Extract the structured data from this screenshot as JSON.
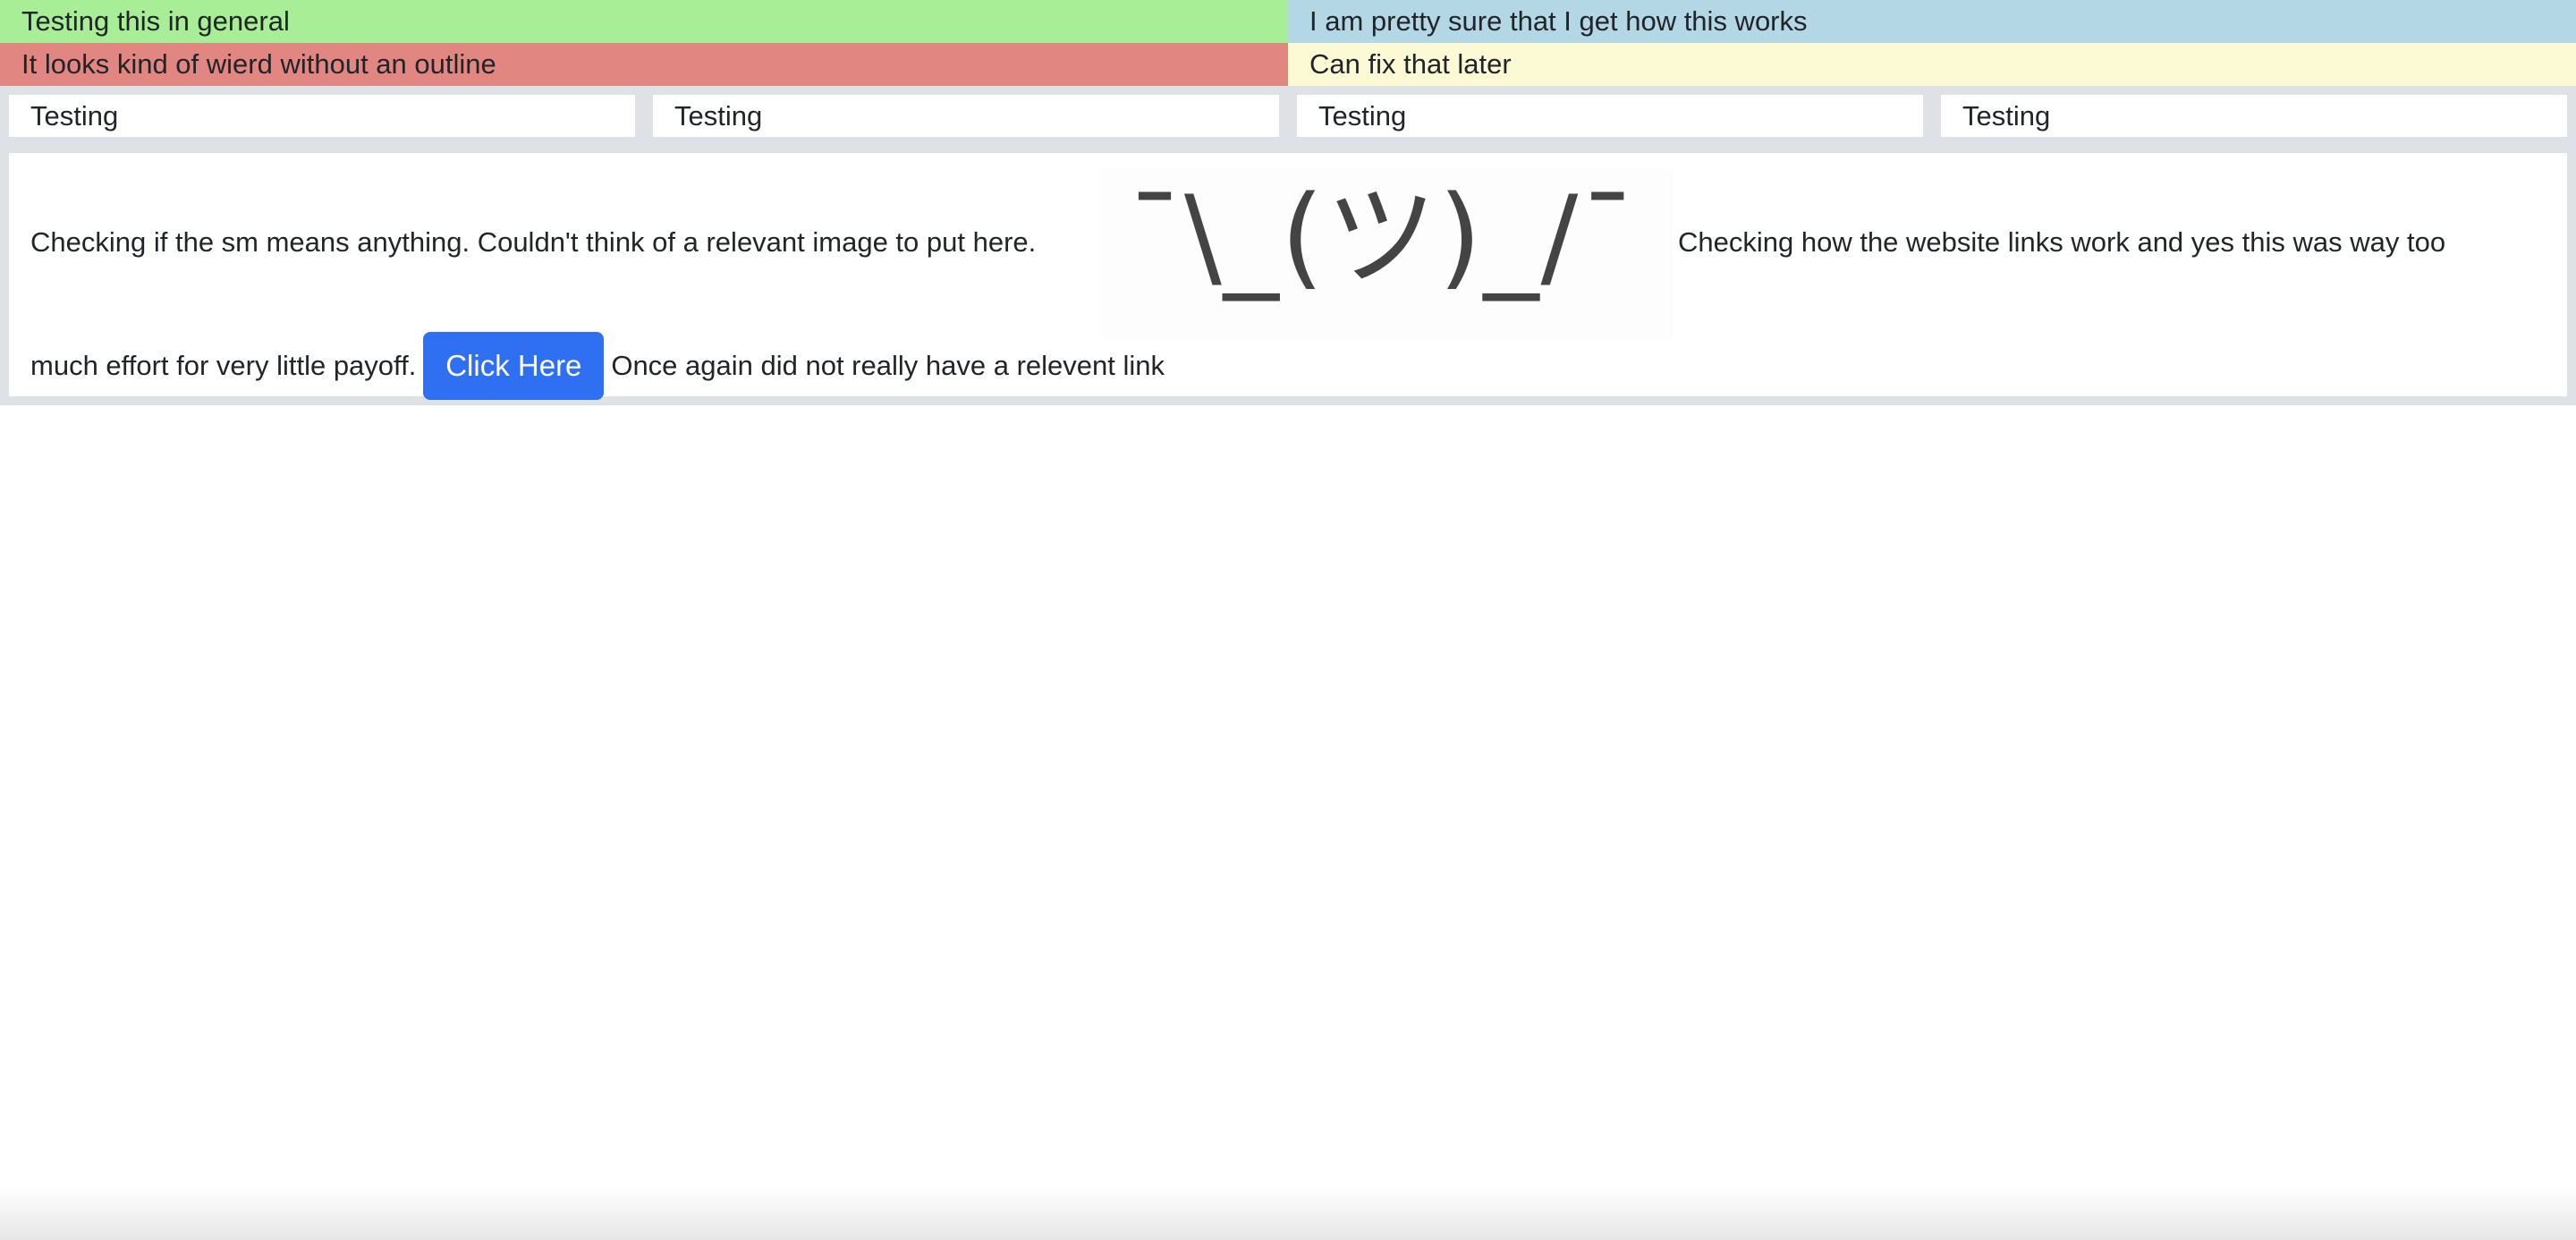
{
  "colors": {
    "green": "#a7ee97",
    "blue": "#b4d7e6",
    "red": "#e28682",
    "yellow": "#fbfad4",
    "band_gray": "#dee2e6",
    "button_blue": "#2f6ff2"
  },
  "top_rows": [
    [
      "Testing this in general",
      "I am pretty sure that I get how this works"
    ],
    [
      "It looks kind of wierd without an outline",
      "Can fix that later"
    ]
  ],
  "testing_boxes": [
    "Testing",
    "Testing",
    "Testing",
    "Testing"
  ],
  "content": {
    "text_left": "Checking if the sm means anything. Couldn't think of a relevant image to put here.",
    "shrug_image_text": "¯\\_(ツ)_/¯",
    "text_right": "Checking how the website links work and yes this was way too",
    "text_line2_start": "much effort for very little payoff.",
    "button_label": "Click Here",
    "text_line2_end": "Once again did not really have a relevent link"
  }
}
